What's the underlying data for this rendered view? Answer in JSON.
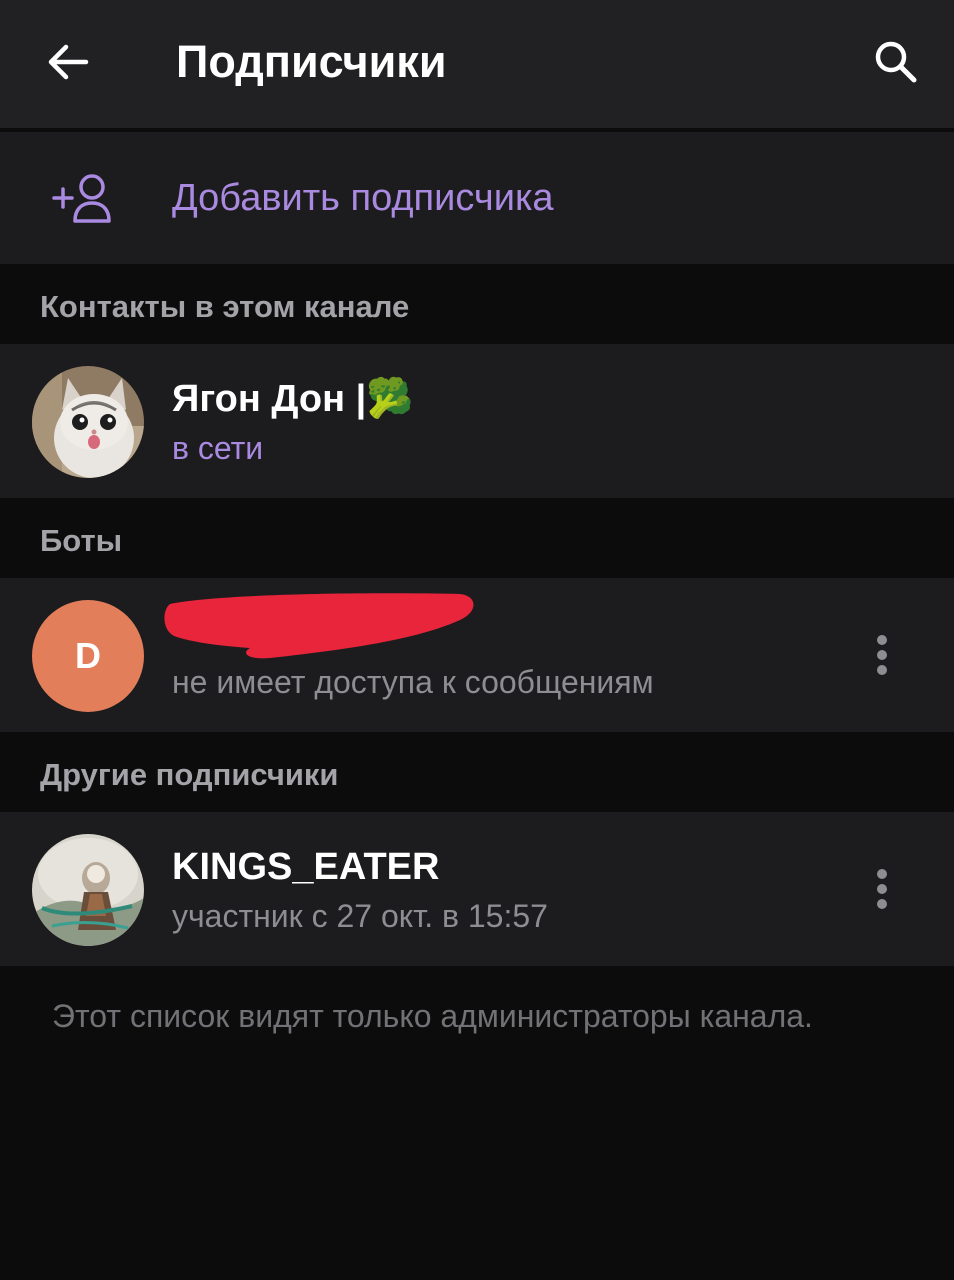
{
  "header": {
    "title": "Подписчики",
    "back_icon": "arrow-left-icon",
    "search_icon": "search-icon"
  },
  "add_subscriber": {
    "label": "Добавить подписчика",
    "icon": "add-user-icon"
  },
  "sections": [
    {
      "label": "Контакты в этом канале",
      "items": [
        {
          "name": "Ягон Дон |",
          "emoji": "🥦",
          "status": "в сети",
          "avatar": "cat-photo"
        }
      ]
    },
    {
      "label": "Боты",
      "items": [
        {
          "name": "",
          "avatar_letter": "D",
          "status": "не имеет доступа к сообщениям",
          "redacted": true
        }
      ]
    },
    {
      "label": "Другие подписчики",
      "items": [
        {
          "name": "KINGS_EATER",
          "status": "участник с 27 окт. в 15:57",
          "avatar": "character-art"
        }
      ]
    }
  ],
  "footer_note": "Этот список видят только администраторы канала.",
  "colors": {
    "accent": "#a98ae0",
    "header_bg": "#212123",
    "row_bg": "#1c1c1e",
    "page_bg": "#0c0c0d",
    "bot_avatar": "#e37e5b",
    "redaction": "#e8253a"
  }
}
